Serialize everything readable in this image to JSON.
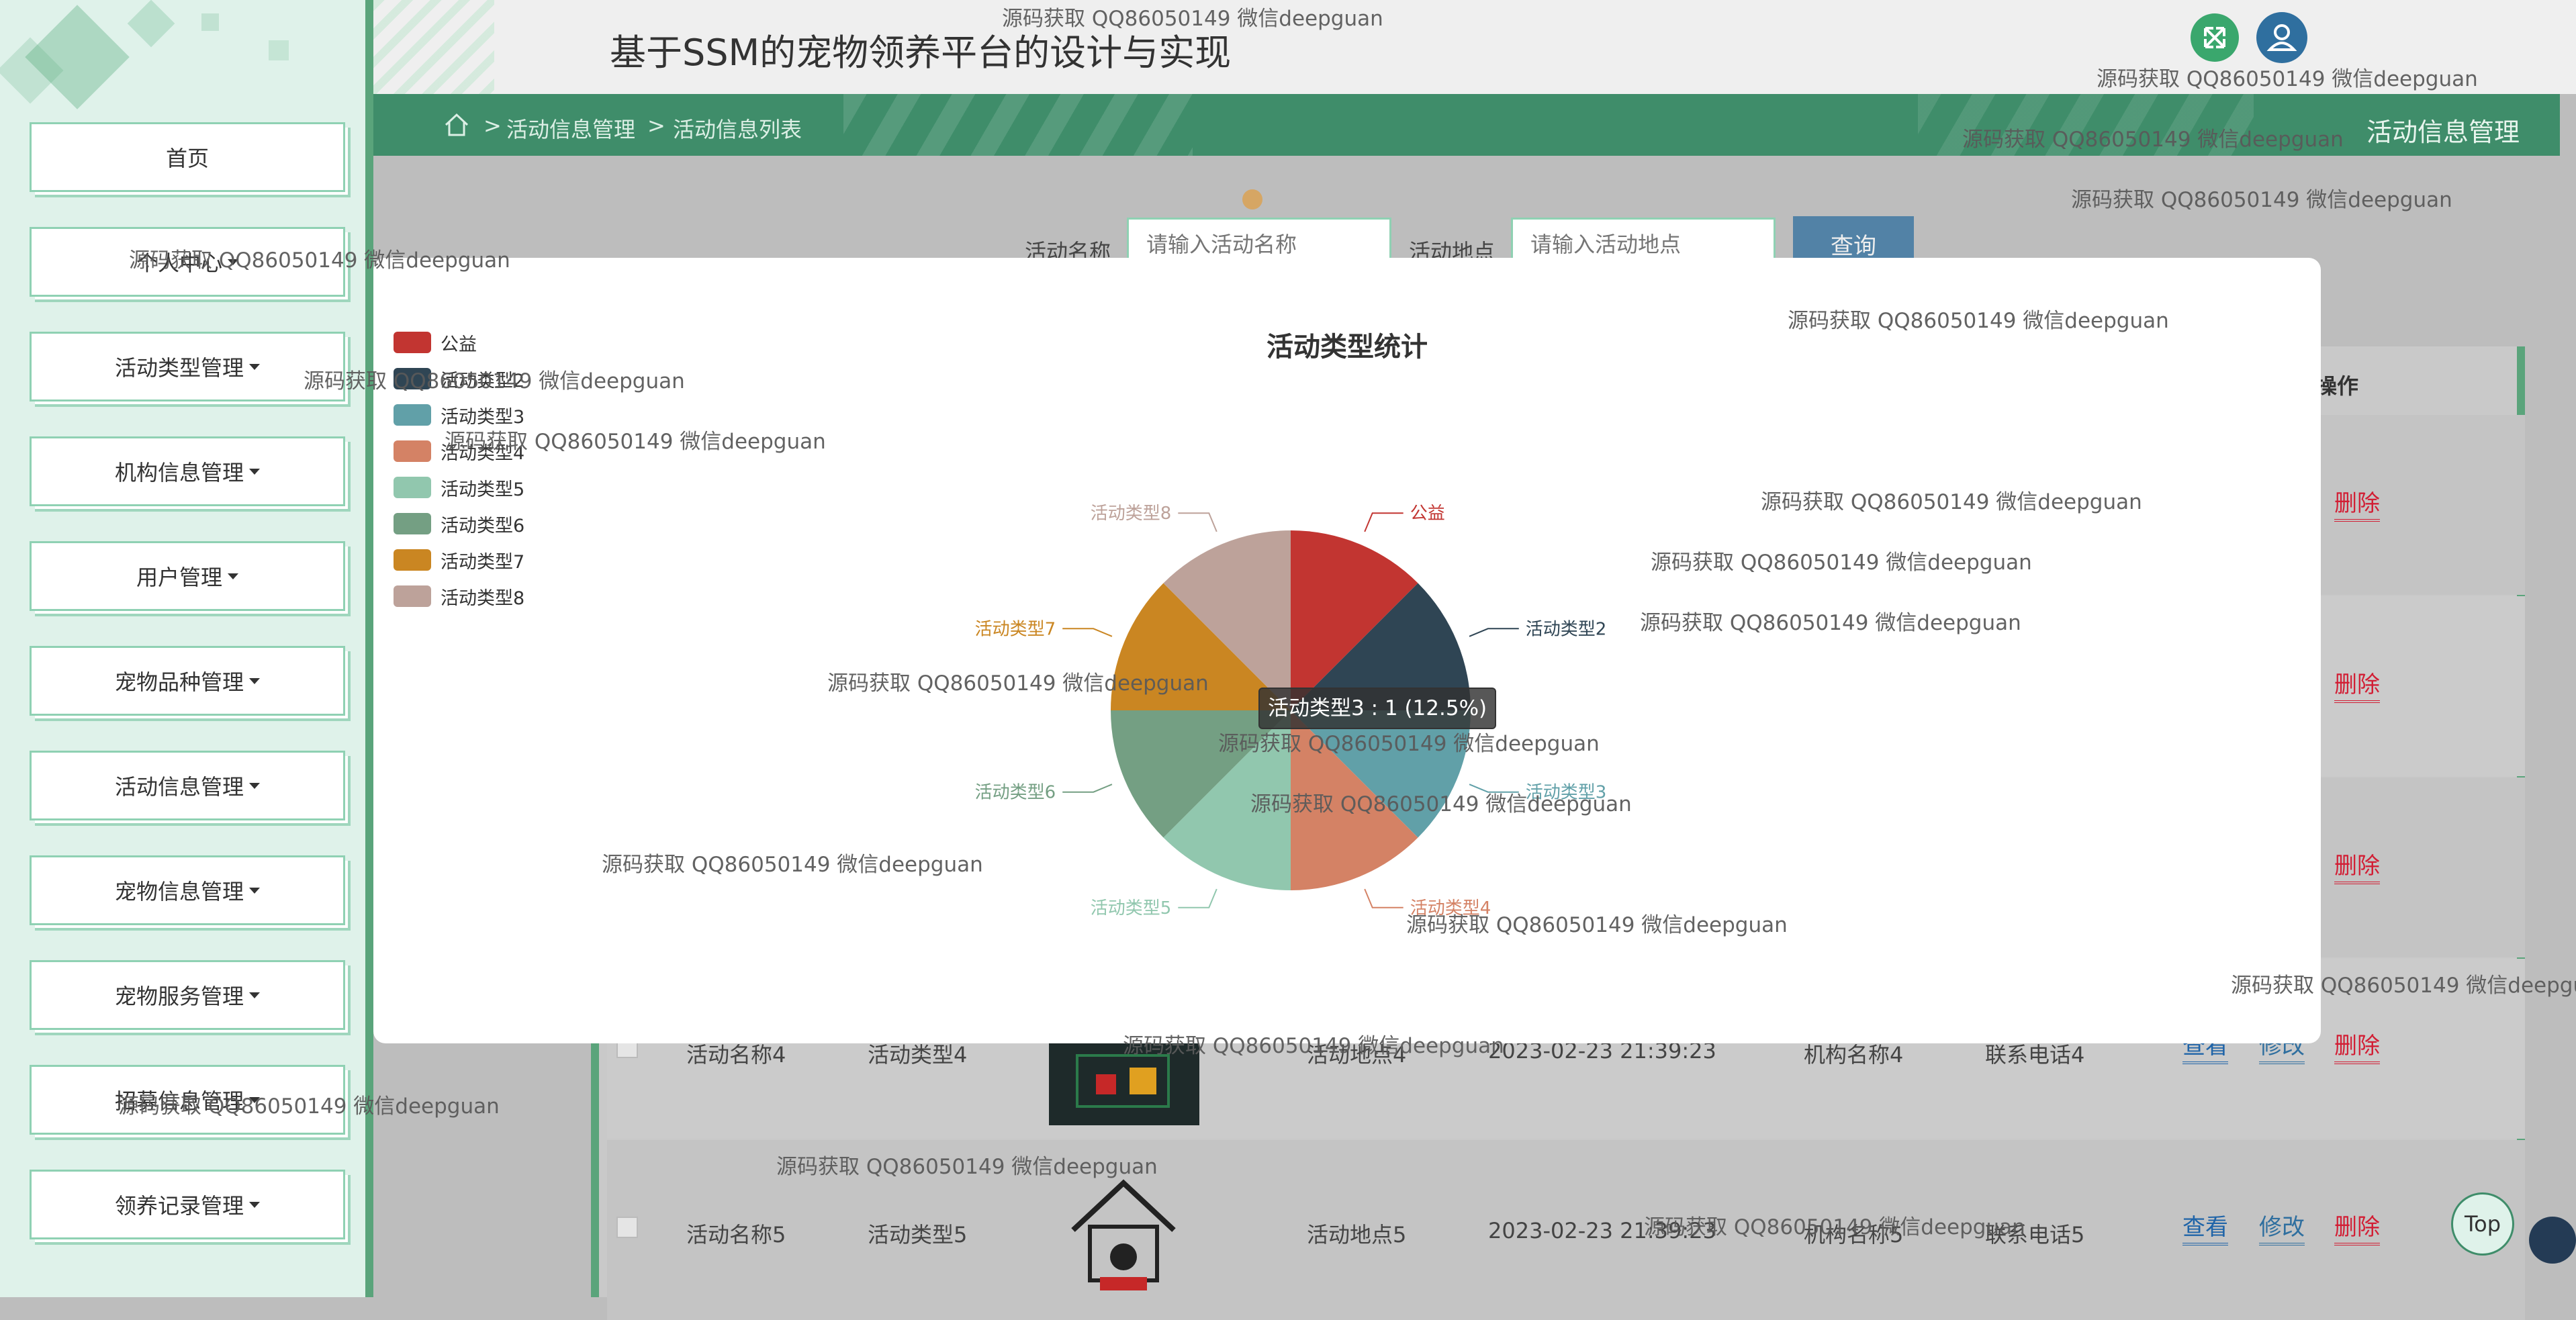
{
  "header": {
    "title": "基于SSM的宠物领养平台的设计与实现"
  },
  "sidebar": {
    "items": [
      {
        "label": "首页",
        "dropdown": false
      },
      {
        "label": "个人中心",
        "dropdown": true
      },
      {
        "label": "活动类型管理",
        "dropdown": true
      },
      {
        "label": "机构信息管理",
        "dropdown": true
      },
      {
        "label": "用户管理",
        "dropdown": true
      },
      {
        "label": "宠物品种管理",
        "dropdown": true
      },
      {
        "label": "活动信息管理",
        "dropdown": true
      },
      {
        "label": "宠物信息管理",
        "dropdown": true
      },
      {
        "label": "宠物服务管理",
        "dropdown": true
      },
      {
        "label": "招募信息管理",
        "dropdown": true
      },
      {
        "label": "领养记录管理",
        "dropdown": true
      }
    ]
  },
  "breadcrumb": {
    "sep": ">",
    "level1": "活动信息管理",
    "level2": "活动信息列表",
    "right_title": "活动信息管理"
  },
  "search": {
    "name_label": "活动名称",
    "name_placeholder": "请输入活动名称",
    "place_label": "活动地点",
    "place_placeholder": "请输入活动地点",
    "button": "查询"
  },
  "table": {
    "ops_header": "操作",
    "actions": {
      "view": "查看",
      "edit": "修改",
      "delete": "删除"
    },
    "rows": [
      {
        "name": "活动名称4",
        "type": "活动类型4",
        "place": "活动地点4",
        "time": "2023-02-23 21:39:23",
        "org": "机构名称4",
        "phone": "联系电话4"
      },
      {
        "name": "活动名称5",
        "type": "活动类型5",
        "place": "活动地点5",
        "time": "2023-02-23 21:39:23",
        "org": "机构名称5",
        "phone": "联系电话5"
      }
    ]
  },
  "chart_data": {
    "type": "pie",
    "title": "活动类型统计",
    "categories": [
      "公益",
      "活动类型2",
      "活动类型3",
      "活动类型4",
      "活动类型5",
      "活动类型6",
      "活动类型7",
      "活动类型8"
    ],
    "values": [
      1,
      1,
      1,
      1,
      1,
      1,
      1,
      1
    ],
    "colors": [
      "#c23531",
      "#2f4554",
      "#61a0a8",
      "#d48265",
      "#91c7ae",
      "#749f83",
      "#ca8622",
      "#bda29a"
    ],
    "legend_position": "top-left",
    "tooltip": "活动类型3 : 1 (12.5%)"
  },
  "watermark": "源码获取 QQ86050149 微信deepguan",
  "top_button": "Top"
}
